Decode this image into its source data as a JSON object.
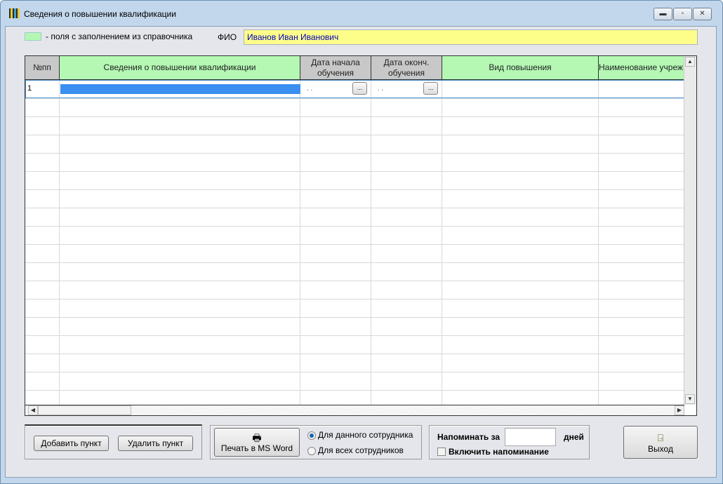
{
  "window": {
    "title": "Сведения о повышении квалификации",
    "controls": [
      "minimize",
      "maximize",
      "close"
    ]
  },
  "legend": {
    "text": "- поля с заполнением из справочника",
    "color": "#b4f8b4"
  },
  "fio": {
    "label": "ФИО",
    "value": "Иванов Иван Иванович"
  },
  "table": {
    "columns": [
      {
        "label": "№пп",
        "style": "gray"
      },
      {
        "label": "Сведения о повышении квалификации",
        "style": "green"
      },
      {
        "label": "Дата начала обучения",
        "style": "gray"
      },
      {
        "label": "Дата оконч. обучения",
        "style": "gray"
      },
      {
        "label": "Вид повышения",
        "style": "green"
      },
      {
        "label": "Наименование учреж",
        "style": "green"
      }
    ],
    "rows": [
      {
        "num": "1",
        "info": "",
        "start": ". .",
        "end": ". .",
        "type": "",
        "org": ""
      }
    ],
    "ellipsis": "..."
  },
  "buttons": {
    "add": "Добавить пункт",
    "delete": "Удалить пункт",
    "print": "Печать в MS Word",
    "exit": "Выход"
  },
  "print_scope": {
    "options": [
      "Для данного сотрудника",
      "Для всех сотрудников"
    ],
    "selected": 0
  },
  "reminder": {
    "label": "Напоминать за",
    "days_value": "",
    "days_label": "дней",
    "enable_label": "Включить напоминание",
    "enabled": false
  }
}
